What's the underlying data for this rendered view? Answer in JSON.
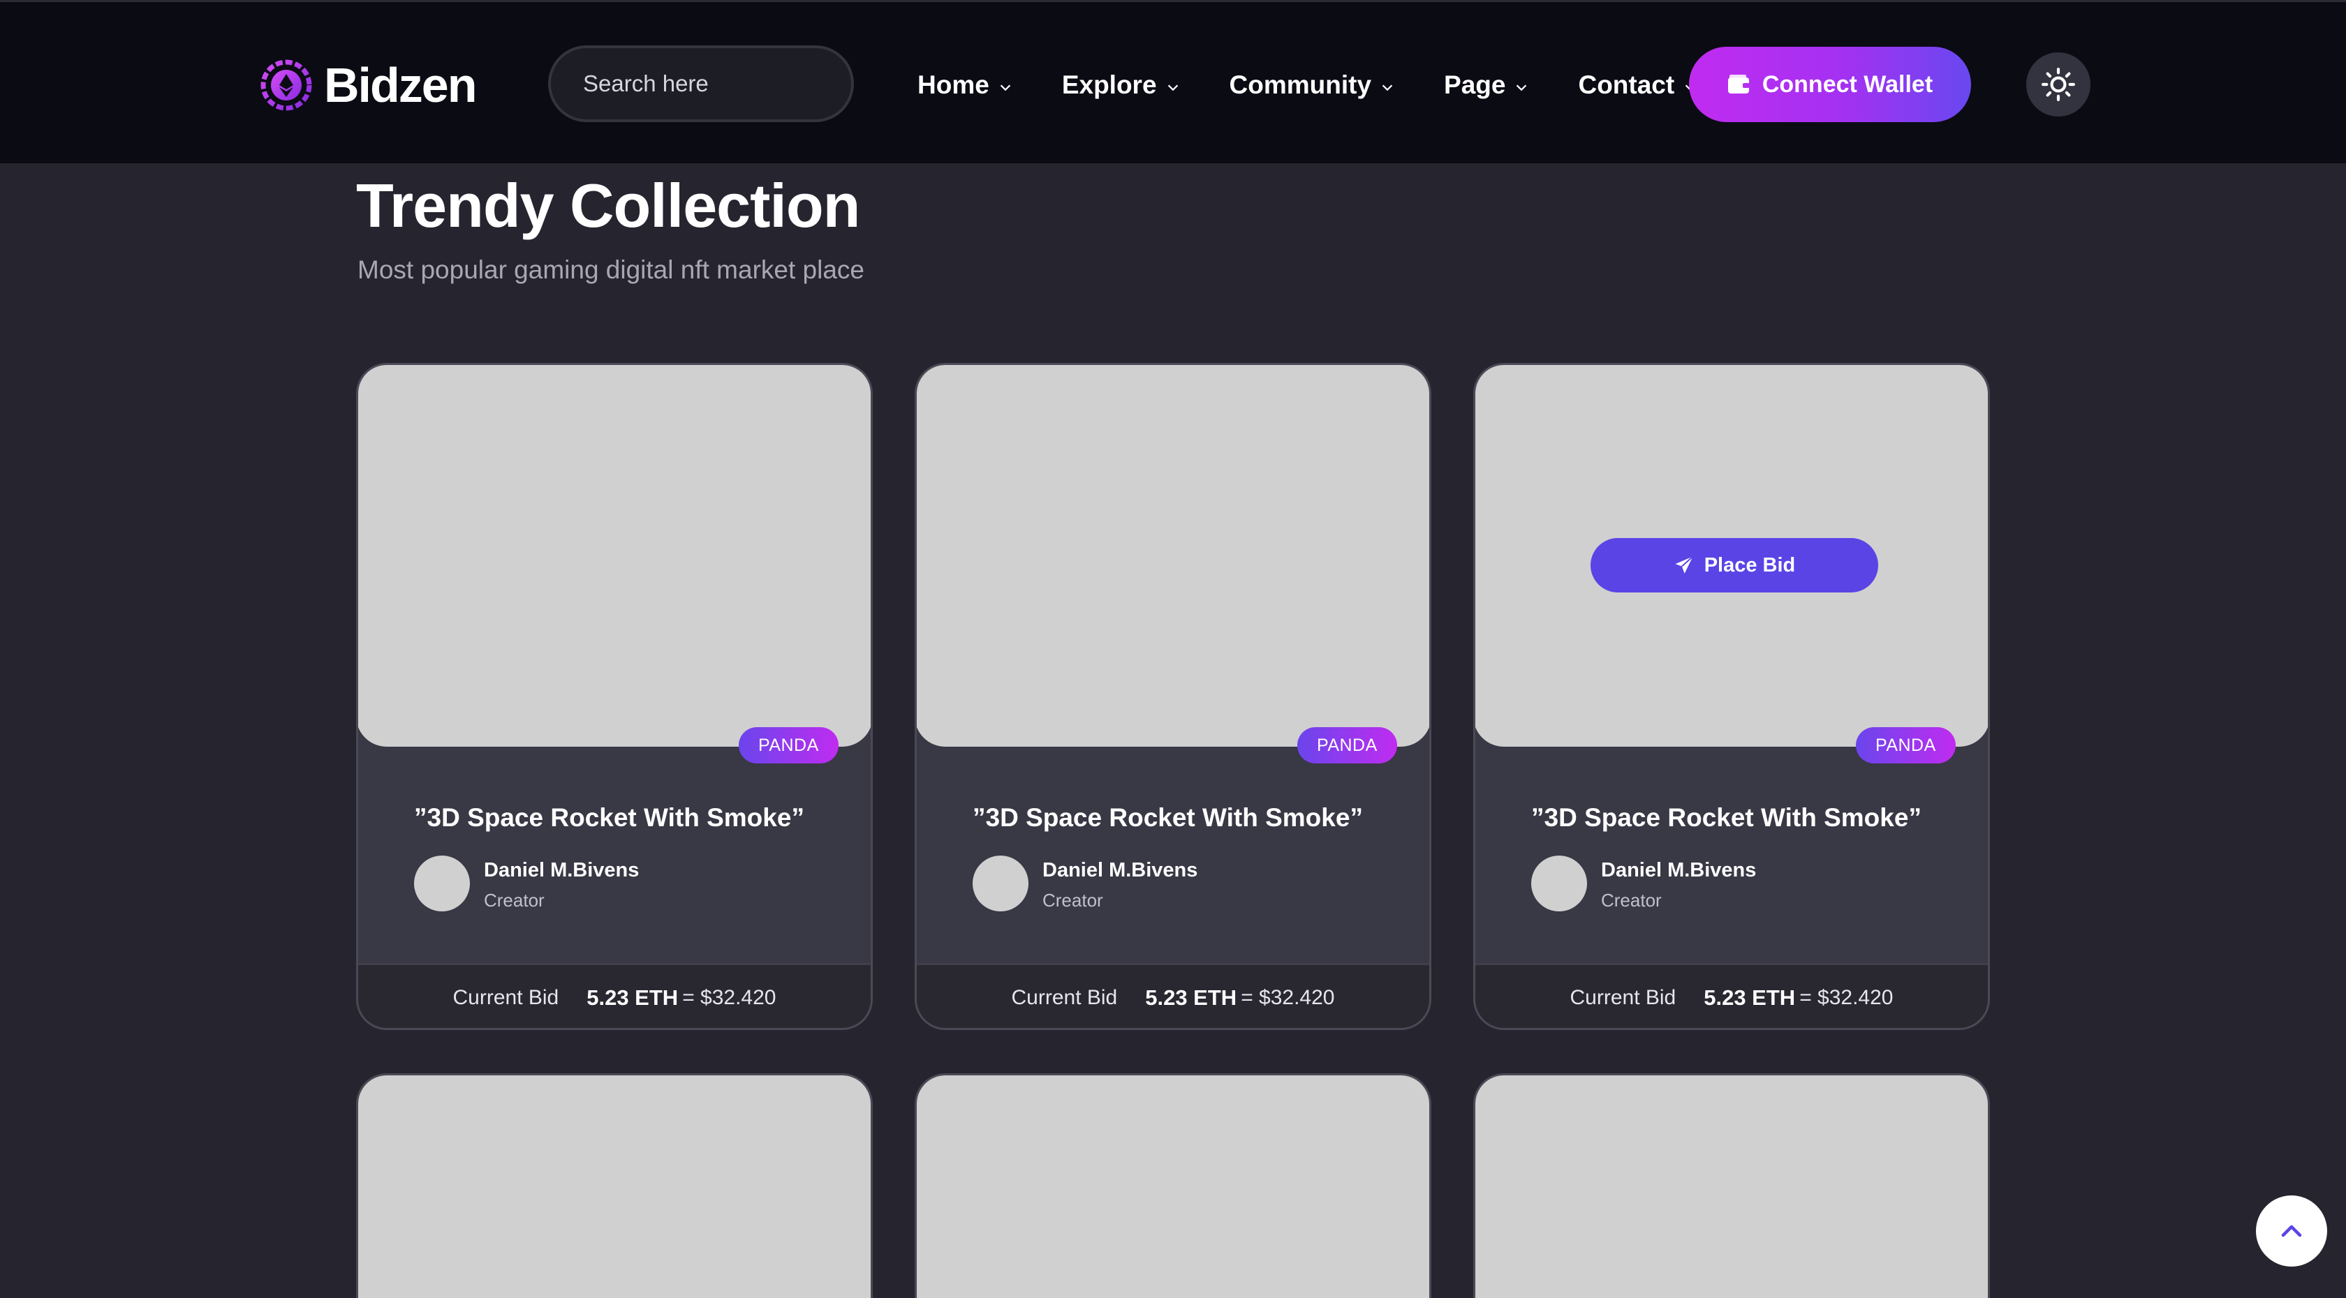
{
  "header": {
    "logo_text": "Bidzen",
    "search_placeholder": "Search here",
    "nav": [
      {
        "label": "Home"
      },
      {
        "label": "Explore"
      },
      {
        "label": "Community"
      },
      {
        "label": "Page"
      },
      {
        "label": "Contact"
      }
    ],
    "wallet_label": "Connect Wallet"
  },
  "section": {
    "title": "Trendy Collection",
    "subtitle": "Most popular gaming digital nft market place"
  },
  "cards": [
    {
      "tag": "PANDA",
      "title": "”3D Space Rocket With Smoke”",
      "creator_name": "Daniel M.Bivens",
      "creator_role": "Creator",
      "bid_label": "Current Bid",
      "bid_eth": "5.23 ETH",
      "bid_usd": "= $32.420"
    },
    {
      "tag": "PANDA",
      "title": "”3D Space Rocket With Smoke”",
      "creator_name": "Daniel M.Bivens",
      "creator_role": "Creator",
      "bid_label": "Current Bid",
      "bid_eth": "5.23 ETH",
      "bid_usd": "= $32.420"
    },
    {
      "tag": "PANDA",
      "title": "”3D Space Rocket With Smoke”",
      "creator_name": "Daniel M.Bivens",
      "creator_role": "Creator",
      "bid_label": "Current Bid",
      "bid_eth": "5.23 ETH",
      "bid_usd": "= $32.420",
      "place_bid_label": "Place Bid"
    }
  ],
  "colors": {
    "page_bg": "#26252f",
    "header_bg": "#0b0b14",
    "accent_purple": "#c02cf0",
    "accent_indigo": "#5a44e6",
    "card_bg": "#393845",
    "image_placeholder": "#d0d0d0"
  },
  "icons": [
    "logo-mark-icon",
    "search-icon",
    "chevron-down-icon",
    "wallet-icon",
    "sun-icon",
    "paper-plane-icon",
    "chevron-up-icon"
  ]
}
